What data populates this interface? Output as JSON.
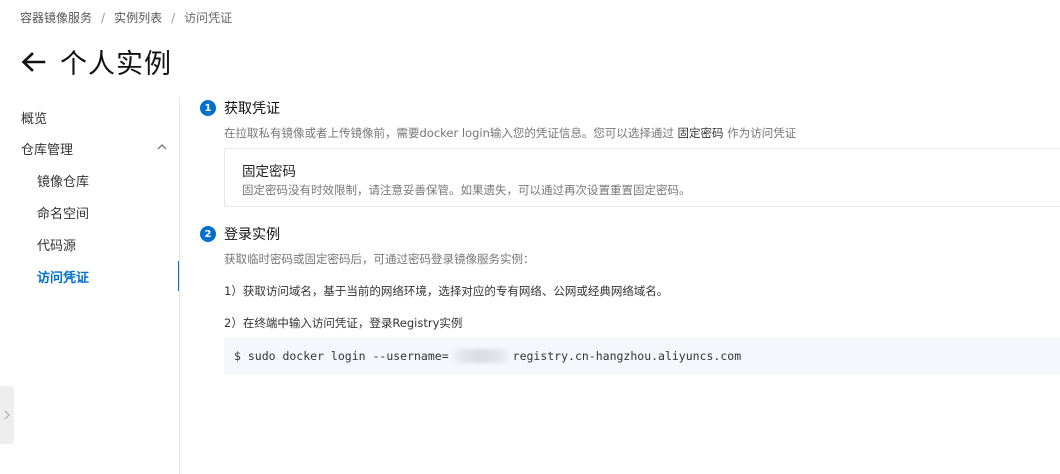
{
  "breadcrumb": {
    "items": [
      "容器镜像服务",
      "实例列表",
      "访问凭证"
    ],
    "separator": "/"
  },
  "header": {
    "back_icon": "arrow-left-icon",
    "title": "个人实例"
  },
  "sidebar": {
    "items": [
      {
        "label": "概览",
        "level": 1
      },
      {
        "label": "仓库管理",
        "level": 1,
        "expanded": true,
        "icon": "chevron-up-icon"
      },
      {
        "label": "镜像仓库",
        "level": 2
      },
      {
        "label": "命名空间",
        "level": 2
      },
      {
        "label": "代码源",
        "level": 2
      },
      {
        "label": "访问凭证",
        "level": 2,
        "active": true
      }
    ],
    "collapse_icon": "chevron-right-icon"
  },
  "steps": [
    {
      "number": "1",
      "title": "获取凭证",
      "desc_prefix": "在拉取私有镜像或者上传镜像前，需要docker login输入您的凭证信息。您可以选择通过",
      "desc_highlight": "固定密码",
      "desc_suffix": "作为访问凭证",
      "card": {
        "title": "固定密码",
        "desc": "固定密码没有时效限制，请注意妥善保管。如果遗失，可以通过再次设置重置固定密码。"
      }
    },
    {
      "number": "2",
      "title": "登录实例",
      "desc": "获取临时密码或固定密码后，可通过密码登录镜像服务实例：",
      "instruction_1": "1）获取访问域名，基于当前的网络环境，选择对应的专有网络、公网或经典网络域名。",
      "instruction_2": "2）在终端中输入访问凭证，登录Registry实例",
      "command_prefix": "$ sudo docker login --username=",
      "command_suffix": "registry.cn-hangzhou.aliyuncs.com"
    }
  ],
  "colors": {
    "accent": "#0070cc",
    "code_bg": "#f4f8fc",
    "border": "#e6e6e6"
  }
}
